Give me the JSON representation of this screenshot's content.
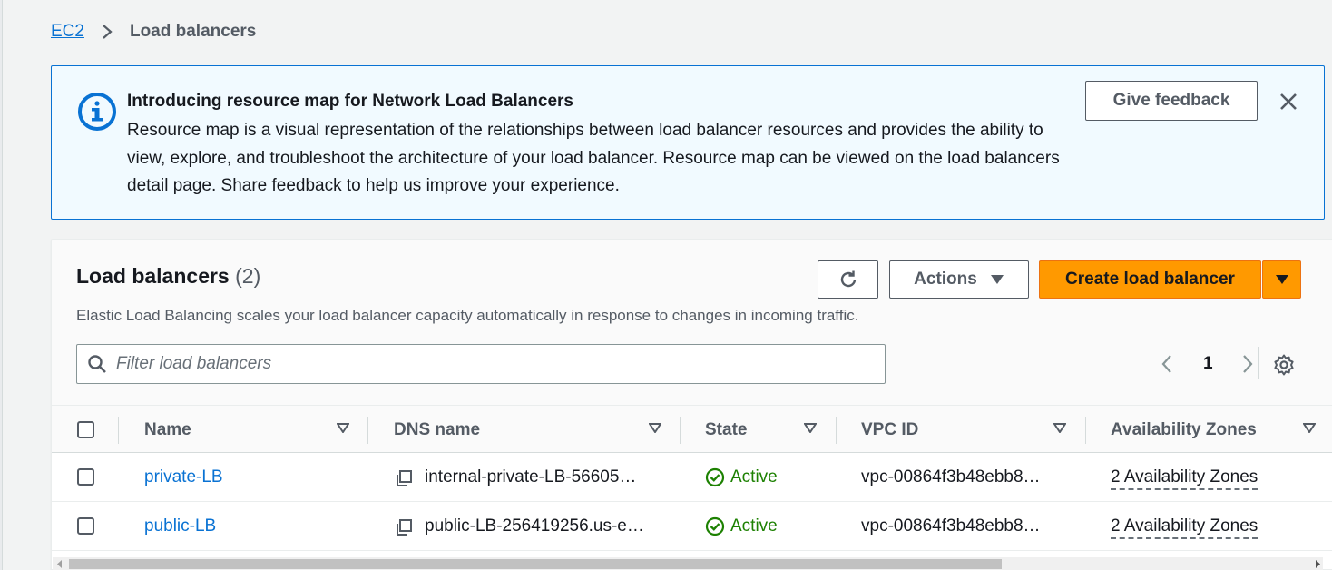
{
  "breadcrumb": {
    "root": "EC2",
    "current": "Load balancers"
  },
  "banner": {
    "title": "Introducing resource map for Network Load Balancers",
    "body": "Resource map is a visual representation of the relationships between load balancer resources and provides the ability to view, explore, and troubleshoot the architecture of your load balancer. Resource map can be viewed on the load balancers detail page. Share feedback to help us improve your experience.",
    "feedback_label": "Give feedback",
    "icon": "info-icon"
  },
  "panel": {
    "title": "Load balancers",
    "count": "(2)",
    "description": "Elastic Load Balancing scales your load balancer capacity automatically in response to changes in incoming traffic.",
    "actions_label": "Actions",
    "create_label": "Create load balancer",
    "search_placeholder": "Filter load balancers",
    "page_number": "1"
  },
  "table": {
    "columns": [
      "Name",
      "DNS name",
      "State",
      "VPC ID",
      "Availability Zones"
    ],
    "rows": [
      {
        "name": "private-LB",
        "dns": "internal-private-LB-56605…",
        "state": "Active",
        "vpc": "vpc-00864f3b48ebb8…",
        "az": "2 Availability Zones"
      },
      {
        "name": "public-LB",
        "dns": "public-LB-256419256.us-e…",
        "state": "Active",
        "vpc": "vpc-00864f3b48ebb8…",
        "az": "2 Availability Zones"
      }
    ]
  },
  "colors": {
    "link": "#0972d3",
    "primary_button": "#ff9900",
    "success": "#1d8102",
    "info_border": "#0972d3",
    "info_bg": "#f1faff"
  }
}
